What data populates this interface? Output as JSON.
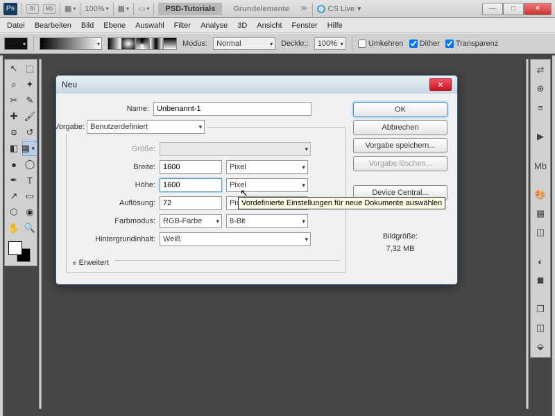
{
  "topbar": {
    "logo": "Ps",
    "br": "Br",
    "mb": "Mb",
    "zoom": "100%",
    "tab_active": "PSD-Tutorials",
    "tab_inactive": "Grundelemente",
    "cslive": "CS Live"
  },
  "menu": {
    "datei": "Datei",
    "bearbeiten": "Bearbeiten",
    "bild": "Bild",
    "ebene": "Ebene",
    "auswahl": "Auswahl",
    "filter": "Filter",
    "analyse": "Analyse",
    "dreid": "3D",
    "ansicht": "Ansicht",
    "fenster": "Fenster",
    "hilfe": "Hilfe"
  },
  "optbar": {
    "modus_lbl": "Modus:",
    "modus_val": "Normal",
    "deckkr_lbl": "Deckkr.:",
    "deckkr_val": "100%",
    "umkehren": "Umkehren",
    "dither": "Dither",
    "transparenz": "Transparenz"
  },
  "dialog": {
    "title": "Neu",
    "name_lbl": "Name:",
    "name_val": "Unbenannt-1",
    "vorgabe_lbl": "Vorgabe:",
    "vorgabe_val": "Benutzerdefiniert",
    "groesse_lbl": "Größe:",
    "breite_lbl": "Breite:",
    "breite_val": "1600",
    "breite_unit": "Pixel",
    "hoehe_lbl": "Höhe:",
    "hoehe_val": "1600",
    "hoehe_unit": "Pixel",
    "aufloesung_lbl": "Auflösung:",
    "aufloesung_val": "72",
    "aufloesung_unit": "Pixel/Zoll",
    "farbmodus_lbl": "Farbmodus:",
    "farbmodus_val": "RGB-Farbe",
    "farbmodus_bit": "8-Bit",
    "hintergrund_lbl": "Hintergrundinhalt:",
    "hintergrund_val": "Weiß",
    "erweitert": "Erweitert",
    "ok": "OK",
    "abbrechen": "Abbrechen",
    "vorgabe_speichern": "Vorgabe speichern...",
    "vorgabe_loeschen": "Vorgabe löschen...",
    "device_central": "Device Central...",
    "bildgroesse_lbl": "Bildgröße:",
    "bildgroesse_val": "7,32 MB"
  },
  "tooltip": "Vordefinierte Einstellungen für neue Dokumente auswählen"
}
